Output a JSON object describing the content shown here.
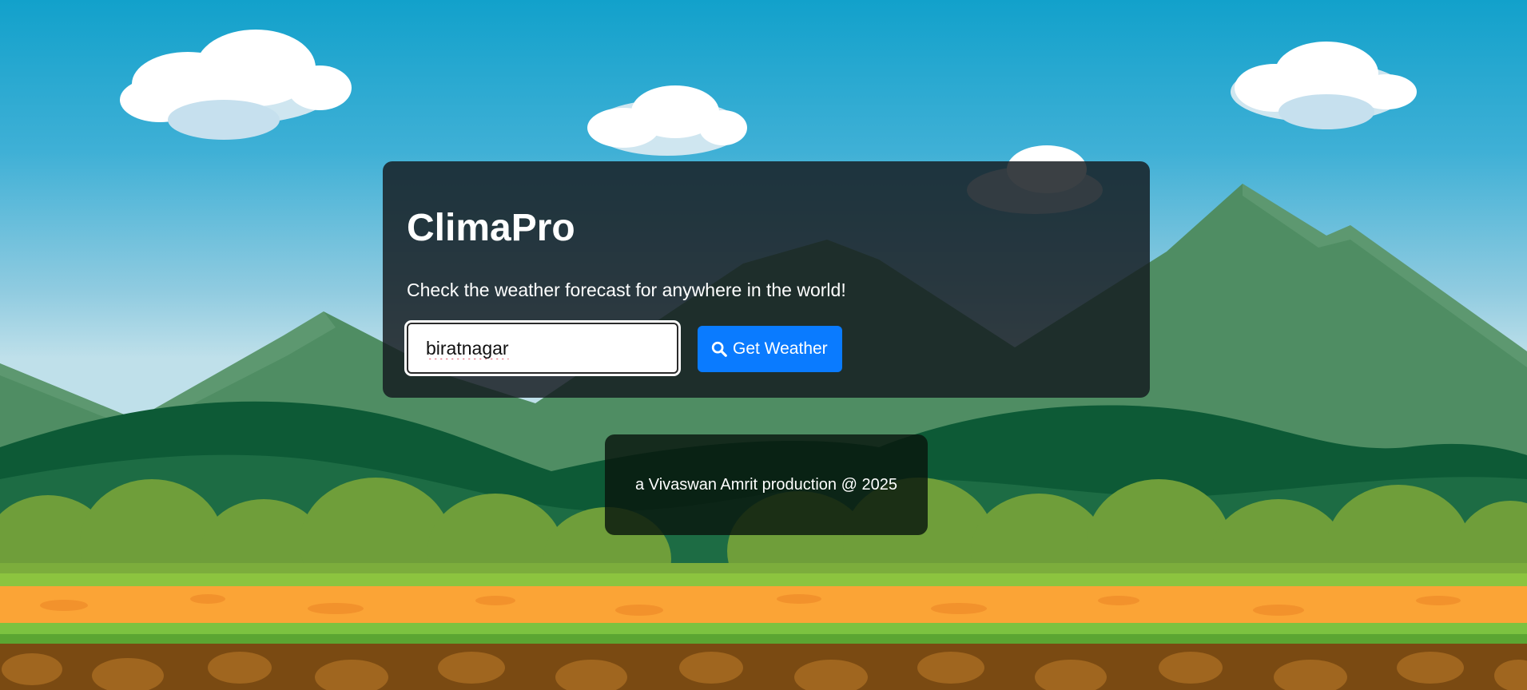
{
  "app": {
    "title": "ClimaPro",
    "subtitle": "Check the weather forecast for anywhere in the world!"
  },
  "search": {
    "value": "biratnagar",
    "button_label": "Get Weather",
    "button_icon": "search-icon"
  },
  "footer": {
    "text": "a Vivaswan Amrit production @ 2025"
  },
  "colors": {
    "button": "#0a7bff",
    "card": "#161c20",
    "sky": "#12a1cb",
    "mountain": "#3f8a5c",
    "ground": "#fba436",
    "soil": "#7a4a12"
  }
}
